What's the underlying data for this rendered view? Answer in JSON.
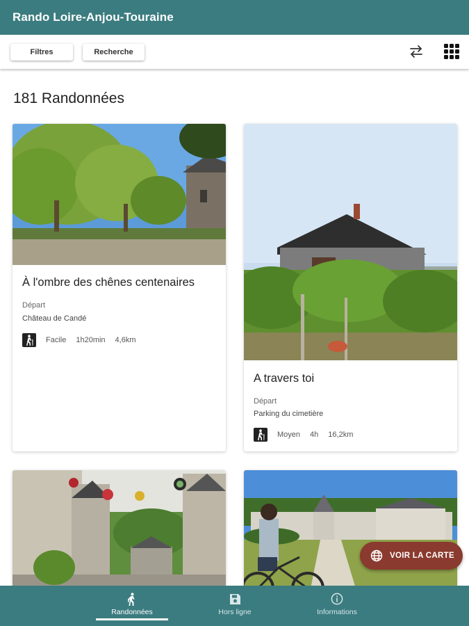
{
  "app": {
    "title": "Rando Loire-Anjou-Touraine"
  },
  "toolbar": {
    "filters_label": "Filtres",
    "search_label": "Recherche",
    "icons": [
      "swap-arrows-icon",
      "grid-apps-icon"
    ]
  },
  "list": {
    "count_title": "181 Randonnées"
  },
  "cards": [
    {
      "title": "À l'ombre des chênes centenaires",
      "depart_label": "Départ",
      "depart_place": "Château de Candé",
      "difficulty": "Facile",
      "duration": "1h20min",
      "distance": "4,6km"
    },
    {
      "title": "A travers toi",
      "depart_label": "Départ",
      "depart_place": "Parking du cimetière",
      "difficulty": "Moyen",
      "duration": "4h",
      "distance": "16,2km"
    }
  ],
  "fab": {
    "label": "VOIR LA CARTE",
    "icon": "globe-icon"
  },
  "bottom_nav": {
    "items": [
      {
        "label": "Randonnées",
        "icon": "hiker-icon",
        "active": true
      },
      {
        "label": "Hors ligne",
        "icon": "save-icon",
        "active": false
      },
      {
        "label": "Informations",
        "icon": "info-icon",
        "active": false
      }
    ]
  },
  "colors": {
    "primary": "#3b7c80",
    "fab": "#8a3a2e",
    "text": "#222222"
  }
}
